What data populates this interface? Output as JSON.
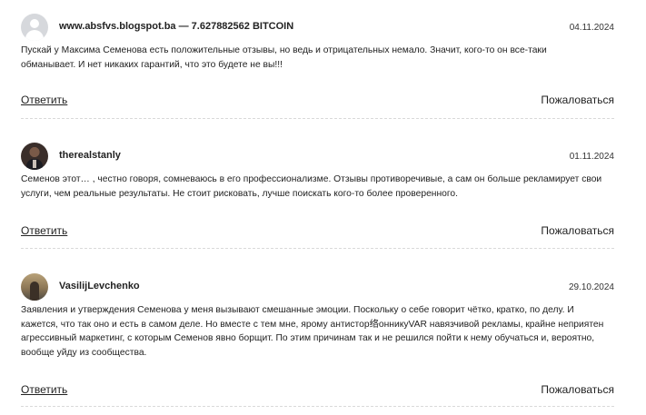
{
  "comments": [
    {
      "author": "www.absfvs.blogspot.ba — 7.627882562 BITCOIN",
      "date": "04.11.2024",
      "avatar": "default-user-icon",
      "text": "Пускай у Максима Семенова есть положительные отзывы, но ведь и отрицательных немало. Значит, кого-то он все-таки обманывает. И нет никаких гарантий, что это будете не вы!!!",
      "reply_label": "Ответить",
      "report_label": "Пожаловаться"
    },
    {
      "author": "therealstanly",
      "date": "01.11.2024",
      "avatar": "user-photo",
      "text": "Семенов этот… , честно говоря, сомневаюсь в его профессионализме. Отзывы противоречивые, а сам он больше рекламирует свои услуги, чем реальные результаты. Не стоит рисковать, лучше поискать кого-то более проверенного.",
      "reply_label": "Ответить",
      "report_label": "Пожаловаться"
    },
    {
      "author": "VasilijLevchenko",
      "date": "29.10.2024",
      "avatar": "user-photo",
      "text": "Заявления и утверждения Семенова у меня вызывают смешанные эмоции. Поскольку о себе говорит чётко, кратко, по делу. И кажется, что так оно и есть в самом деле. Но вместе с тем мне, ярому антистор络онникуVAR навязчивой рекламы, крайне неприятен агрессивный маркетинг, с которым Семенов явно борщит. По этим причинам так и не решился пойти к нему обучаться и, вероятно, вообще уйду из сообщества.",
      "reply_label": "Ответить",
      "report_label": "Пожаловаться"
    }
  ]
}
